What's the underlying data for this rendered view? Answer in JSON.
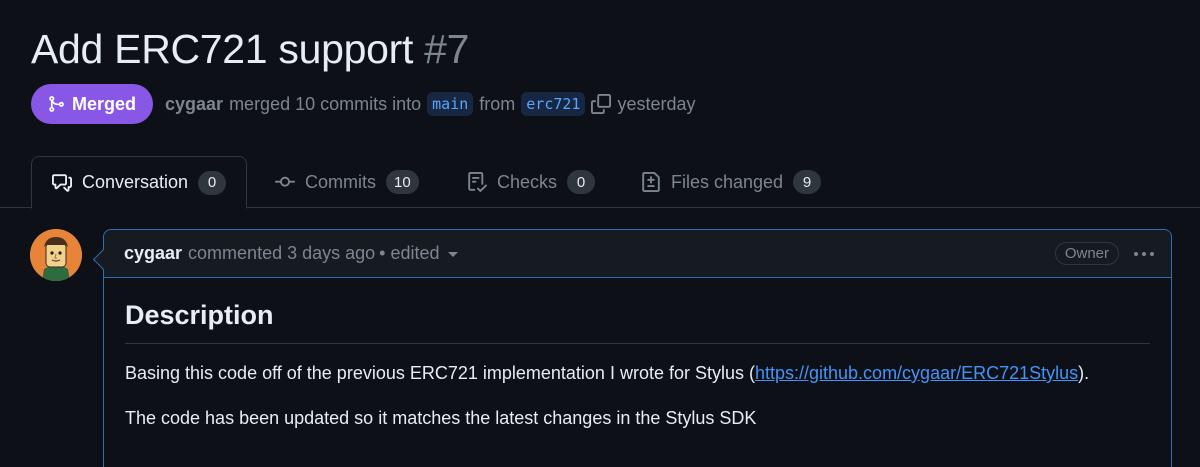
{
  "pr": {
    "title": "Add ERC721 support",
    "number": "#7"
  },
  "meta": {
    "state_label": "Merged",
    "author": "cygaar",
    "merged_text": "merged 10 commits into",
    "base_branch": "main",
    "from_text": "from",
    "head_branch": "erc721",
    "time": "yesterday"
  },
  "tabs": [
    {
      "label": "Conversation",
      "count": "0",
      "icon": "comment-discussion-icon"
    },
    {
      "label": "Commits",
      "count": "10",
      "icon": "git-commit-icon"
    },
    {
      "label": "Checks",
      "count": "0",
      "icon": "checklist-icon"
    },
    {
      "label": "Files changed",
      "count": "9",
      "icon": "file-diff-icon"
    }
  ],
  "comment": {
    "author": "cygaar",
    "meta": "commented 3 days ago",
    "edited": "• edited",
    "role_label": "Owner",
    "heading": "Description",
    "para1_prefix": "Basing this code off of the previous ERC721 implementation I wrote for Stylus (",
    "para1_link": "https://github.com/cygaar/ERC721Stylus",
    "para1_suffix": ").",
    "para2": "The code has been updated so it matches the latest changes in the Stylus SDK"
  },
  "colors": {
    "background": "#0d1117",
    "merged_badge": "#8957e5",
    "link": "#4493f8",
    "comment_border": "#2f6fb4"
  }
}
